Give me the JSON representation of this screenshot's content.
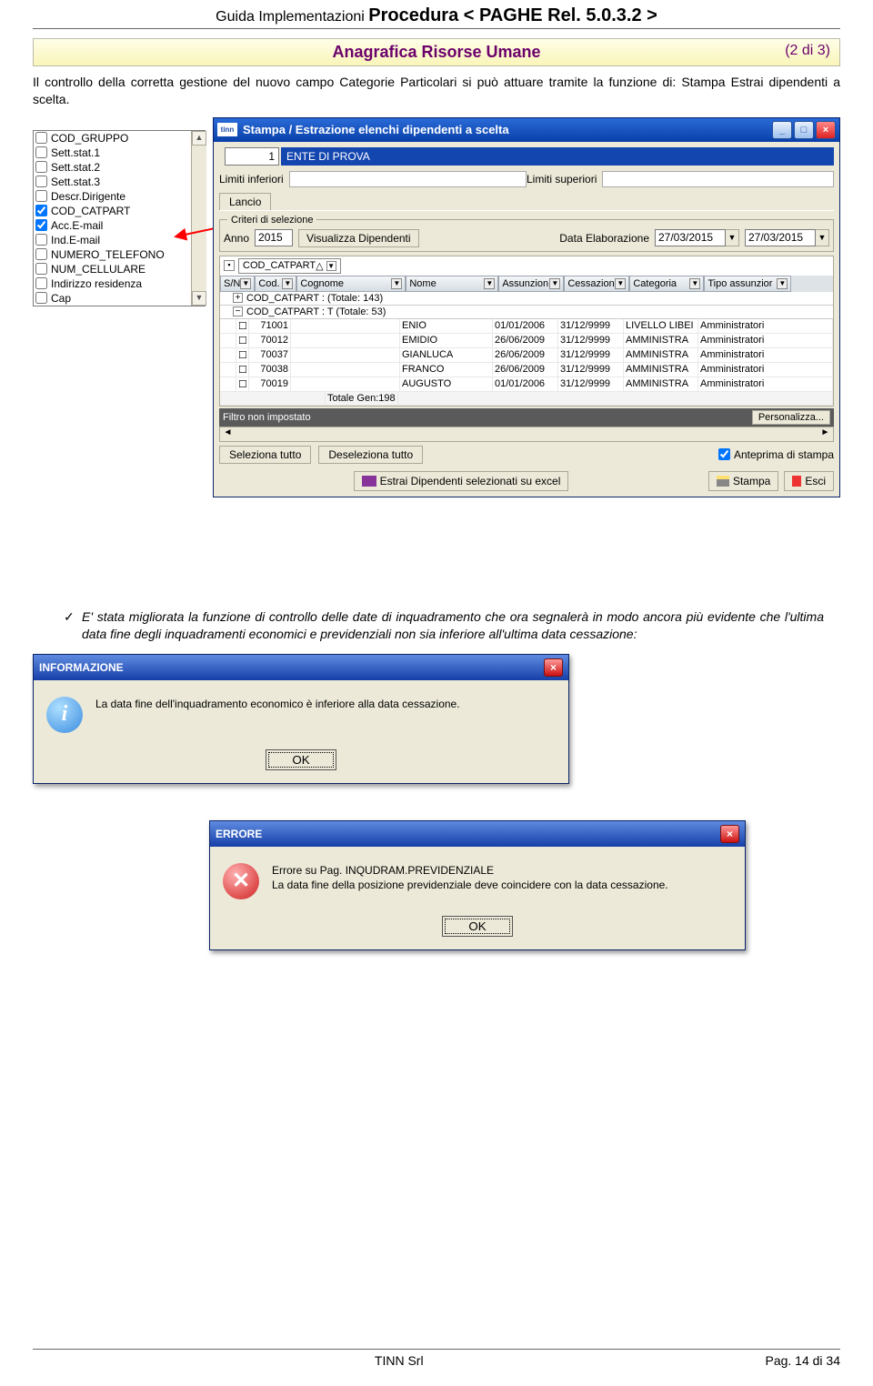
{
  "header": {
    "pre": "Guida  Implementazioni  ",
    "main": "Procedura  < PAGHE  Rel. 5.0.3.2 >"
  },
  "section": {
    "title": "Anagrafica Risorse Umane",
    "page_of": "(2 di 3)"
  },
  "para1": "Il controllo della corretta gestione del nuovo campo Categorie Particolari si può attuare tramite la funzione di: Stampa Estrai dipendenti a scelta.",
  "fieldlist": {
    "items": [
      {
        "label": "COD_GRUPPO",
        "checked": false
      },
      {
        "label": "Sett.stat.1",
        "checked": false
      },
      {
        "label": "Sett.stat.2",
        "checked": false
      },
      {
        "label": "Sett.stat.3",
        "checked": false
      },
      {
        "label": "Descr.Dirigente",
        "checked": false
      },
      {
        "label": "COD_CATPART",
        "checked": true
      },
      {
        "label": "Acc.E-mail",
        "checked": true
      },
      {
        "label": "Ind.E-mail",
        "checked": false
      },
      {
        "label": "NUMERO_TELEFONO",
        "checked": false
      },
      {
        "label": "NUM_CELLULARE",
        "checked": false
      },
      {
        "label": "Indirizzo residenza",
        "checked": false
      },
      {
        "label": "Cap",
        "checked": false
      }
    ]
  },
  "win1": {
    "title": "Stampa / Estrazione elenchi dipendenti a scelta",
    "ente_num": "1",
    "ente_name": "ENTE DI PROVA",
    "limiti_inf_label": "Limiti inferiori",
    "limiti_sup_label": "Limiti superiori",
    "tab_label": "Lancio",
    "criteri_legend": "Criteri di selezione",
    "anno_label": "Anno",
    "anno_value": "2015",
    "vis_btn": "Visualizza Dipendenti",
    "data_elab_label": "Data Elaborazione",
    "date1": "27/03/2015",
    "date2": "27/03/2015",
    "group_field": "COD_CATPART",
    "columns": [
      "S/N",
      "Cod.",
      "Cognome",
      "Nome",
      "Assunzion",
      "Cessazion",
      "Categoria",
      "Tipo assunzior"
    ],
    "group1": "COD_CATPART :  (Totale: 143)",
    "group2": "COD_CATPART : T (Totale: 53)",
    "rows": [
      {
        "cod": "71001",
        "cognome": "",
        "nome": "ENIO",
        "ass": "01/01/2006",
        "cess": "31/12/9999",
        "cat": "LIVELLO LIBEI",
        "tipo": "Amministratori"
      },
      {
        "cod": "70012",
        "cognome": "",
        "nome": "EMIDIO",
        "ass": "26/06/2009",
        "cess": "31/12/9999",
        "cat": "AMMINISTRA",
        "tipo": "Amministratori"
      },
      {
        "cod": "70037",
        "cognome": "",
        "nome": "GIANLUCA",
        "ass": "26/06/2009",
        "cess": "31/12/9999",
        "cat": "AMMINISTRA",
        "tipo": "Amministratori"
      },
      {
        "cod": "70038",
        "cognome": "",
        "nome": "FRANCO",
        "ass": "26/06/2009",
        "cess": "31/12/9999",
        "cat": "AMMINISTRA",
        "tipo": "Amministratori"
      },
      {
        "cod": "70019",
        "cognome": "",
        "nome": "AUGUSTO",
        "ass": "01/01/2006",
        "cess": "31/12/9999",
        "cat": "AMMINISTRA",
        "tipo": "Amministratori"
      }
    ],
    "totale_gen_label": "Totale Gen:",
    "totale_gen": "198",
    "filtro": "Filtro non impostato",
    "personalizza": "Personalizza...",
    "seleziona_tutto": "Seleziona tutto",
    "deseleziona_tutto": "Deseleziona tutto",
    "anteprima_label": "Anteprima di stampa",
    "estrai_excel": "Estrai Dipendenti selezionati su excel",
    "stampa": "Stampa",
    "esci": "Esci"
  },
  "para2": "E' stata migliorata la funzione di controllo delle date di inquadramento che ora segnalerà in modo ancora più evidente che l'ultima data fine degli inquadramenti economici e previdenziali non sia inferiore all'ultima data cessazione:",
  "dlg1": {
    "title": "INFORMAZIONE",
    "text": "La data fine dell'inquadramento economico è inferiore alla data cessazione.",
    "ok": "OK"
  },
  "dlg2": {
    "title": "ERRORE",
    "line1": "Errore su Pag. INQUDRAM.PREVIDENZIALE",
    "line2": "La data fine della posizione previdenziale deve coincidere con la data cessazione.",
    "ok": "OK"
  },
  "footer": {
    "company": "TINN  Srl",
    "page": "Pag. 14 di 34"
  }
}
